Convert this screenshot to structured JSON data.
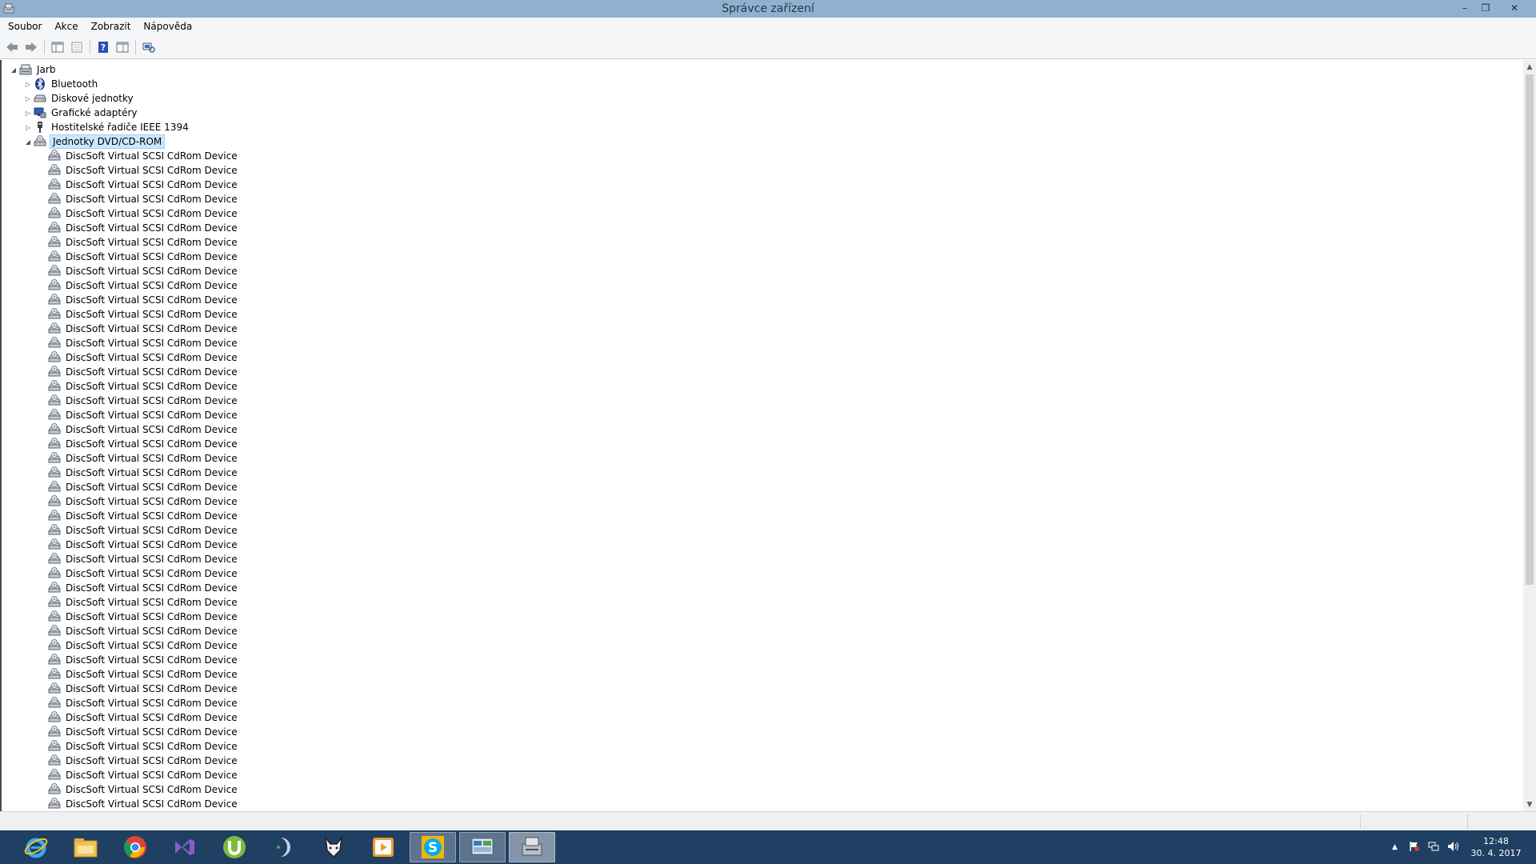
{
  "window": {
    "title": "Správce zařízení",
    "min_glyph": "–",
    "max_glyph": "❐",
    "close_glyph": "✕"
  },
  "menu": [
    "Soubor",
    "Akce",
    "Zobrazit",
    "Nápověda"
  ],
  "toolbar": {
    "buttons": [
      "back-icon",
      "forward-icon",
      "show-hide-tree-icon",
      "properties-icon",
      "help-icon",
      "view-icon",
      "scan-hardware-icon"
    ]
  },
  "tree": {
    "root": "Jarb",
    "categories": [
      {
        "label": "Bluetooth",
        "icon": "bluetooth-icon"
      },
      {
        "label": "Diskové jednotky",
        "icon": "disk-drive-icon"
      },
      {
        "label": "Grafické adaptéry",
        "icon": "display-adapter-icon"
      },
      {
        "label": "Hostitelské řadiče IEEE 1394",
        "icon": "ieee1394-icon"
      },
      {
        "label": "Jednotky DVD/CD-ROM",
        "icon": "dvd-drive-icon",
        "expanded": true,
        "selected": true
      }
    ],
    "device_label": "DiscSoft Virtual SCSI CdRom Device",
    "device_count": 46
  },
  "taskbar": {
    "apps": [
      "internet-explorer-icon",
      "file-explorer-icon",
      "chrome-icon",
      "visual-studio-icon",
      "utorrent-icon",
      "app-icon",
      "fox-app-icon",
      "media-player-icon",
      "skype-icon",
      "control-panel-icon",
      "device-manager-icon"
    ]
  },
  "clock": {
    "time": "12:48",
    "date": "30. 4. 2017"
  },
  "colors": {
    "titlebar": "#8fb0cf",
    "taskbar": "#1f3f63",
    "selection": "#cce8ff"
  }
}
